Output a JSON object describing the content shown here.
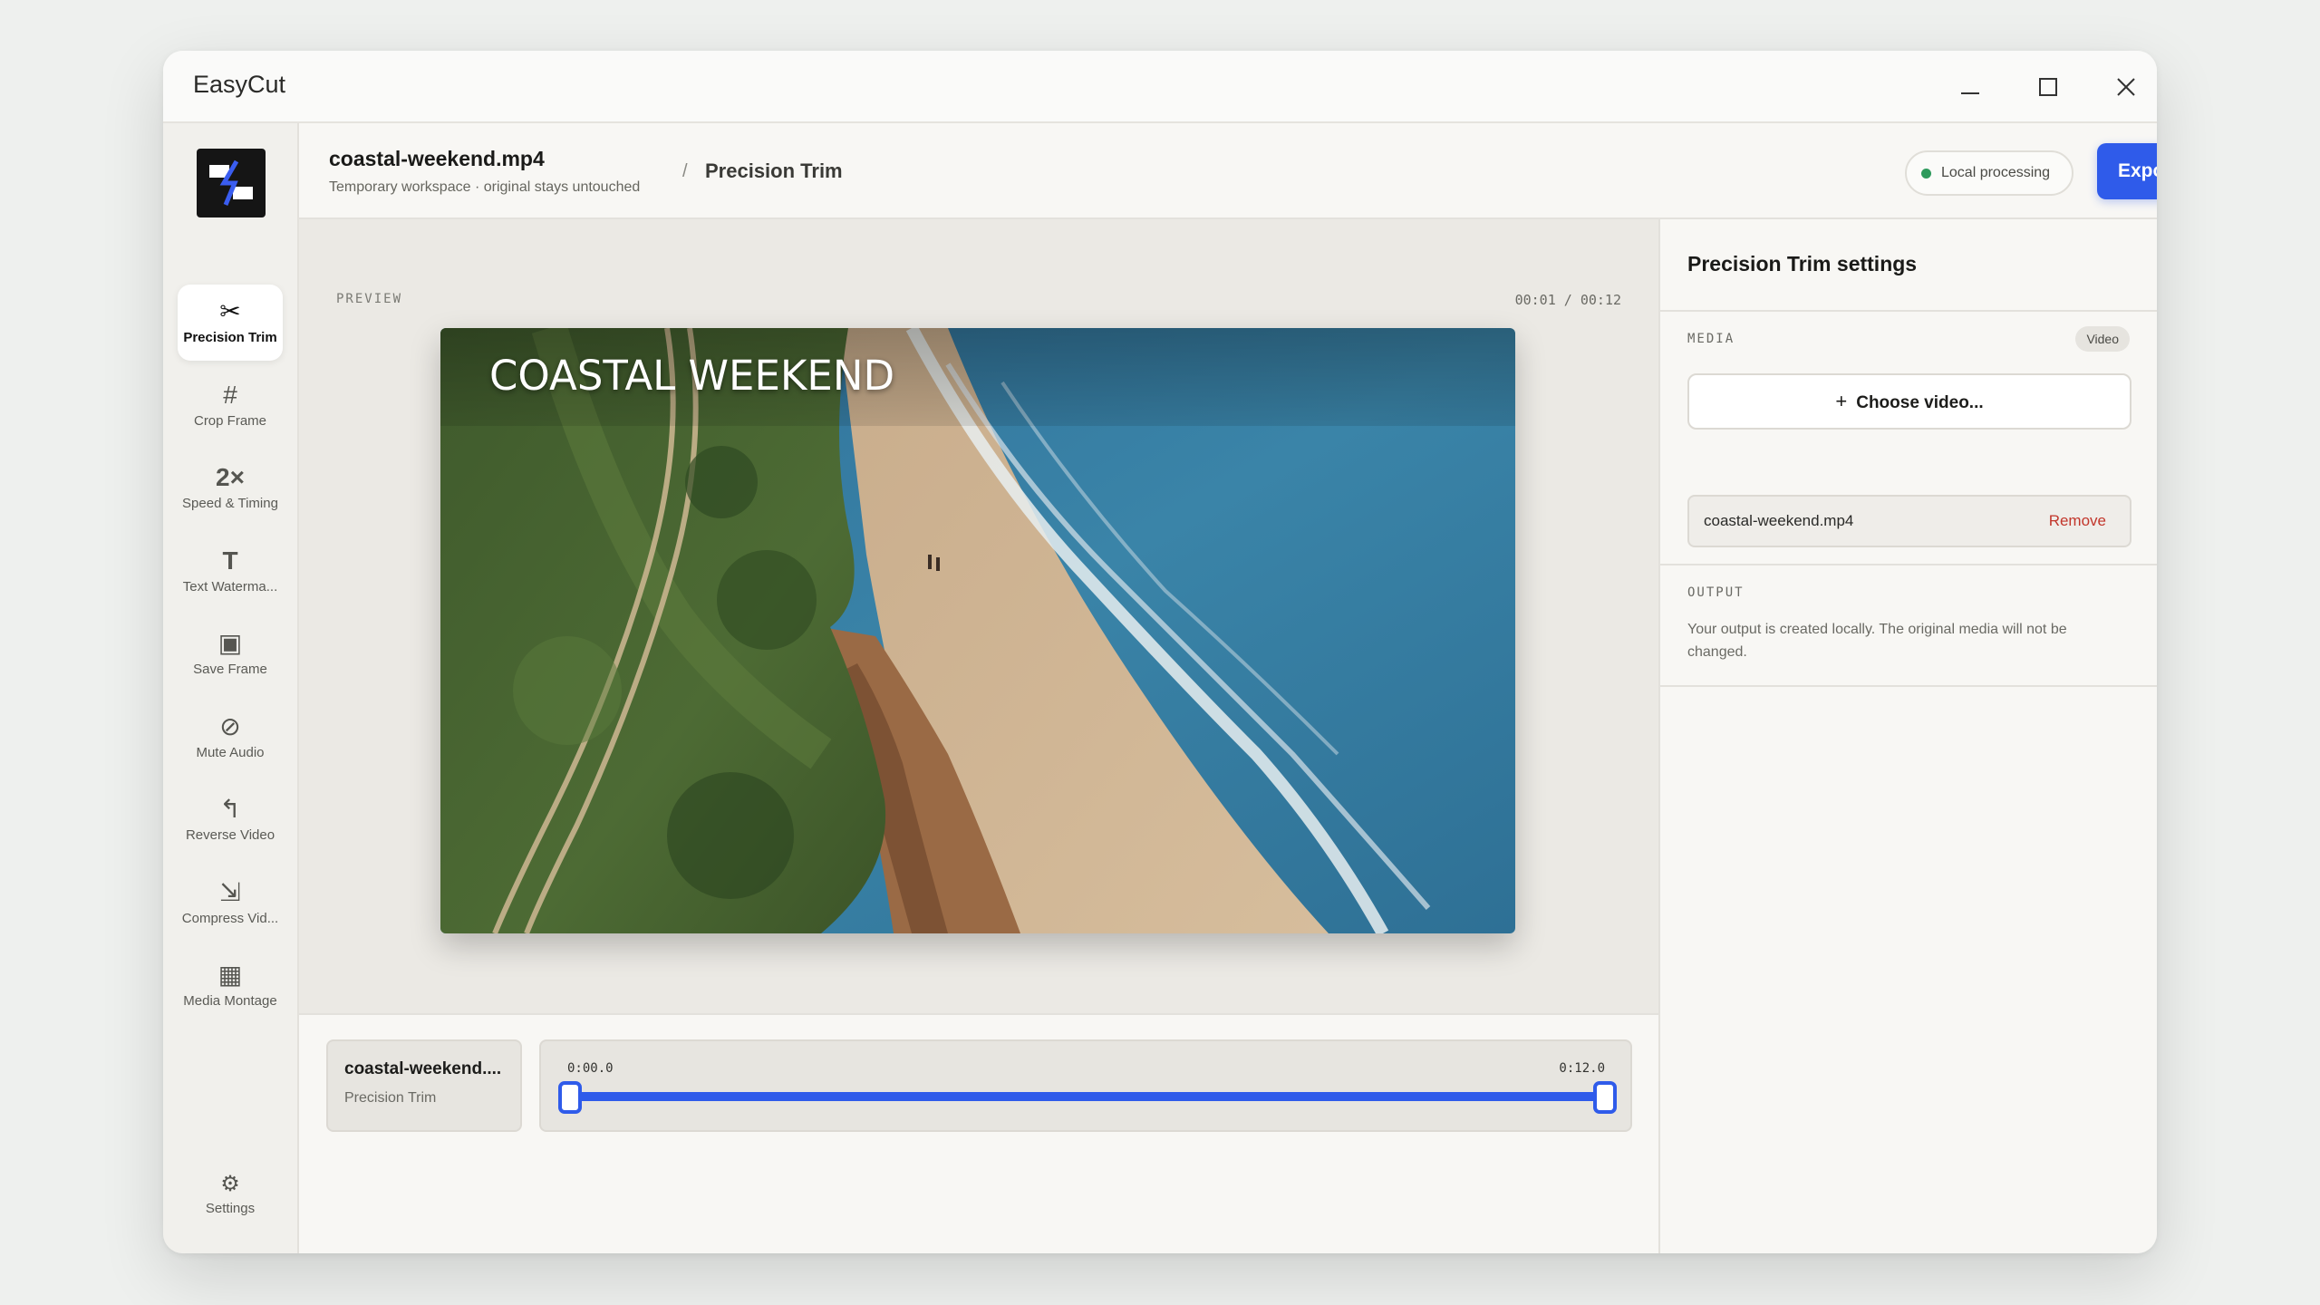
{
  "app": {
    "title": "EasyCut"
  },
  "sidebar": {
    "tools": [
      {
        "label": "Precision Trim",
        "icon": "✂",
        "active": true
      },
      {
        "label": "Crop Frame",
        "icon": "#"
      },
      {
        "label": "Speed & Timing",
        "icon": "2×"
      },
      {
        "label": "Text Waterma...",
        "icon": "T"
      },
      {
        "label": "Save Frame",
        "icon": "▣"
      },
      {
        "label": "Mute Audio",
        "icon": "⊘"
      },
      {
        "label": "Reverse Video",
        "icon": "↰"
      },
      {
        "label": "Compress Vid...",
        "icon": "⇲"
      },
      {
        "label": "Media Montage",
        "icon": "▦"
      }
    ],
    "settings": {
      "label": "Settings",
      "icon": "⚙"
    }
  },
  "header": {
    "file_name": "coastal-weekend.mp4",
    "subtitle": "Temporary workspace · original stays untouched",
    "separator": "/",
    "crumb": "Precision Trim",
    "local_label": "Local processing",
    "export_label": "Export Range",
    "export_icon": "↗"
  },
  "preview": {
    "label": "PREVIEW",
    "timecode": "00:01 / 00:12",
    "video_title": "COASTAL WEEKEND"
  },
  "timeline": {
    "clip_name": "coastal-weekend....",
    "clip_tool": "Precision Trim",
    "start": "0:00.0",
    "end": "0:12.0",
    "range_start_fraction": 0.0,
    "range_end_fraction": 1.0
  },
  "panel": {
    "title": "Precision Trim settings",
    "media_label": "MEDIA",
    "media_badge": "Video",
    "choose_label": "Choose video...",
    "file_name": "coastal-weekend.mp4",
    "remove_label": "Remove",
    "output_label": "OUTPUT",
    "output_text": "Your output is created locally. The original media will not be changed."
  },
  "colors": {
    "accent": "#2f5bea",
    "status_ok": "#2e9a5c",
    "danger": "#c2362b"
  }
}
